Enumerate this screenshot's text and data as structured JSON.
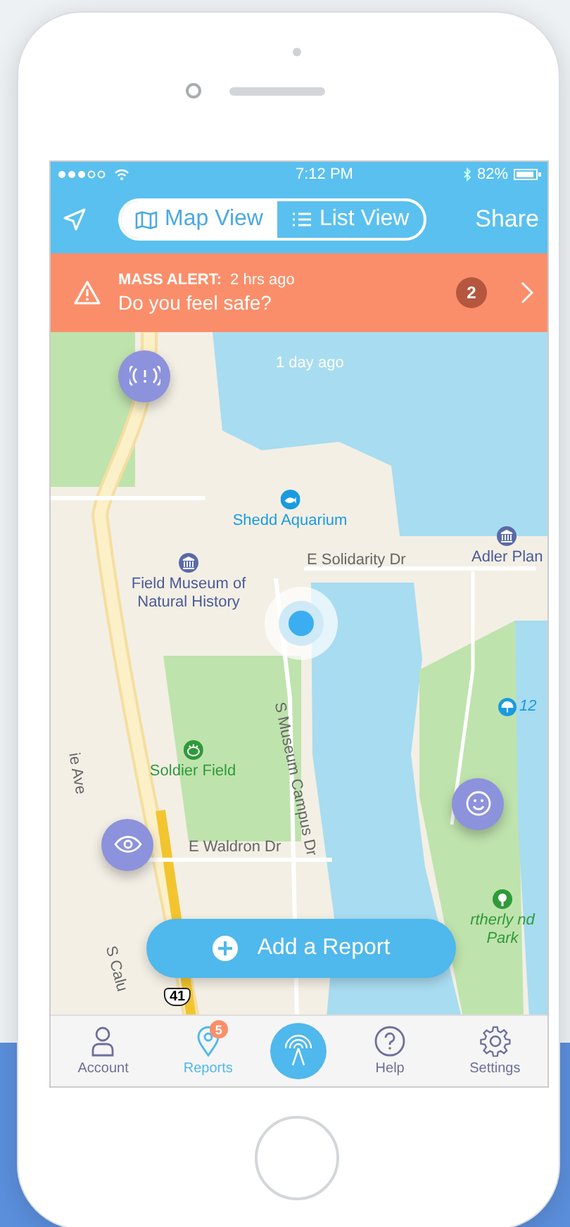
{
  "status_bar": {
    "time": "7:12 PM",
    "battery": "82%"
  },
  "nav": {
    "tabs": [
      {
        "label": "Map View",
        "selected": true
      },
      {
        "label": "List View",
        "selected": false
      }
    ],
    "share": "Share"
  },
  "alert": {
    "title": "MASS ALERT:",
    "time": "2 hrs ago",
    "message": "Do you feel safe?",
    "count": "2"
  },
  "map": {
    "timestamp": "1 day ago",
    "labels": [
      {
        "kind": "aquarium",
        "text": "Shedd Aquarium"
      },
      {
        "kind": "street",
        "text": "E Solidarity Dr"
      },
      {
        "kind": "museum",
        "text": "Field Museum of Natural History"
      },
      {
        "kind": "museum",
        "text": "Adler Plan"
      },
      {
        "kind": "street",
        "text": "S Museum Campus Dr"
      },
      {
        "kind": "street",
        "text": "ie Ave"
      },
      {
        "kind": "stadium",
        "text": "Soldier Field"
      },
      {
        "kind": "street",
        "text": "E Waldron Dr"
      },
      {
        "kind": "beach",
        "text": "12"
      },
      {
        "kind": "park",
        "text": "rtherly nd Park"
      },
      {
        "kind": "street",
        "text": "S Calu"
      },
      {
        "kind": "highway",
        "text": "41"
      }
    ],
    "markers": [
      {
        "kind": "signal"
      },
      {
        "kind": "eye"
      },
      {
        "kind": "smile"
      }
    ]
  },
  "add_button": "Add a Report",
  "tab_bar": [
    {
      "kind": "account",
      "label": "Account",
      "selected": false
    },
    {
      "kind": "reports",
      "label": "Reports",
      "selected": true,
      "badge": "5"
    },
    {
      "kind": "help",
      "label": "Help",
      "selected": false
    },
    {
      "kind": "settings",
      "label": "Settings",
      "selected": false
    }
  ]
}
